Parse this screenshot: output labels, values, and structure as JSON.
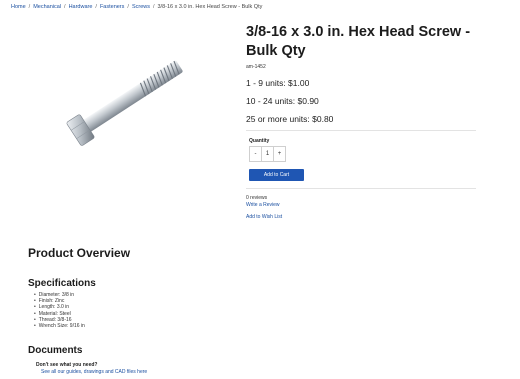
{
  "breadcrumb": {
    "items": [
      "Home",
      "Mechanical",
      "Hardware",
      "Fasteners",
      "Screws"
    ],
    "current": "3/8-16 x 3.0 in. Hex Head Screw - Bulk Qty",
    "separator": "/"
  },
  "product": {
    "title": "3/8-16 x 3.0 in. Hex Head Screw - Bulk Qty",
    "sku": "am-1452",
    "image_icon": "hex-head-screw-image",
    "prices": [
      "1 - 9 units: $1.00",
      "10 - 24 units: $0.90",
      "25 or more units: $0.80"
    ]
  },
  "cart": {
    "quantity_label": "Quantity",
    "quantity_value": "1",
    "decrement": "-",
    "increment": "+",
    "add_label": "Add to Cart"
  },
  "reviews": {
    "count_text": "0 reviews",
    "write_link": "Write a Review",
    "wish_list": "Add to Wish List"
  },
  "overview": {
    "heading": "Product Overview",
    "specs_heading": "Specifications",
    "specs": [
      "Diameter: 3/8 in",
      "Finish: Zinc",
      "Length: 3.0 in",
      "Material: Steel",
      "Thread: 3/8-16",
      "Wrench Size: 9/16 in"
    ],
    "docs_heading": "Documents",
    "docs_question": "Don't see what you need?",
    "docs_link": "See all our guides, drawings and CAD files here"
  },
  "colors": {
    "accent": "#1f56b3",
    "link": "#1a4fa0"
  }
}
